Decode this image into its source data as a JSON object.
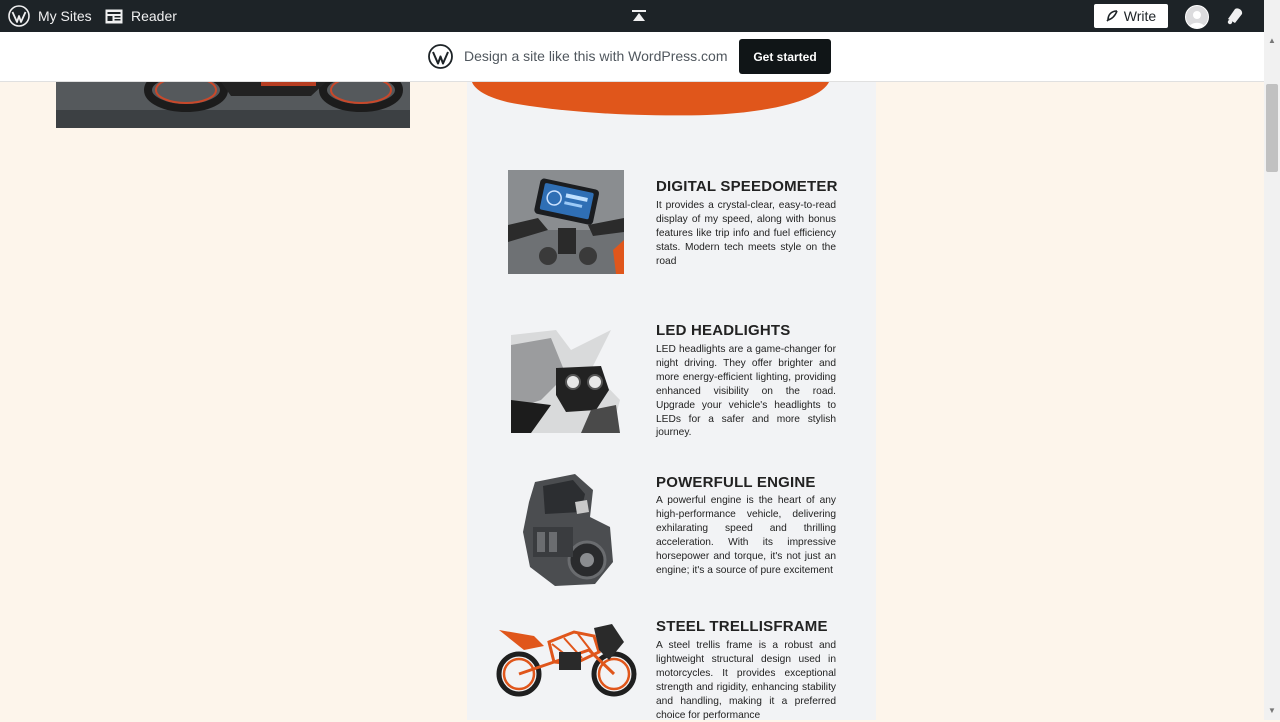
{
  "adminbar": {
    "my_sites": "My Sites",
    "reader": "Reader",
    "write": "Write"
  },
  "banner": {
    "text": "Design a site like this with WordPress.com",
    "button": "Get started"
  },
  "features": [
    {
      "title": "DIGITAL SPEEDOMETER",
      "text": " It provides a crystal-clear, easy-to-read display of my speed, along with bonus features like trip info and fuel efficiency stats. Modern tech meets style on the road"
    },
    {
      "title": "LED HEADLIGHTS",
      "text": "LED headlights are a game-changer for night driving. They offer brighter and more energy-efficient lighting, providing enhanced visibility on the road. Upgrade your vehicle's headlights to LEDs for a safer and more stylish journey."
    },
    {
      "title": "POWERFULL ENGINE",
      "text": "A powerful engine is the heart of any high-performance vehicle, delivering exhilarating speed and thrilling acceleration. With its impressive horsepower and torque, it's not just an engine; it's a source of pure excitement"
    },
    {
      "title": "STEEL TRELLISFRAME",
      "text": "A steel trellis frame is a robust and lightweight structural design used in motorcycles. It provides exceptional strength and rigidity, enhancing stability and handling, making it a preferred choice for performance"
    }
  ],
  "colors": {
    "adminbar": "#1d2327",
    "page_bg": "#fdf5eb",
    "column_bg": "#f2f3f5",
    "accent_orange": "#e0561b",
    "button_dark": "#101517"
  }
}
